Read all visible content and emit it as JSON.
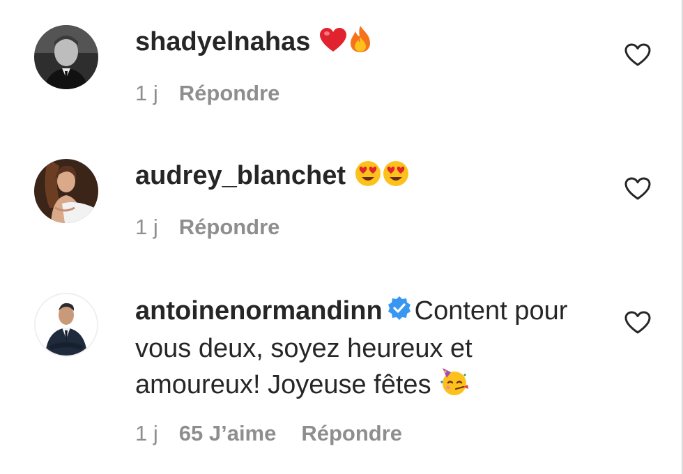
{
  "comments": [
    {
      "username": "shadyelnahas",
      "text": "",
      "emojis": [
        "red-heart-emoji",
        "fire-emoji"
      ],
      "time": "1 j",
      "likes": "",
      "reply_label": "Répondre",
      "verified": false
    },
    {
      "username": "audrey_blanchet",
      "text": "",
      "emojis": [
        "heart-eyes-emoji",
        "heart-eyes-emoji"
      ],
      "time": "1 j",
      "likes": "",
      "reply_label": "Répondre",
      "verified": false
    },
    {
      "username": "antoinenormandinn",
      "text": "Content pour vous deux, soyez heureux et amoureux! Joyeuse fêtes",
      "emojis": [
        "partying-face-emoji"
      ],
      "time": "1 j",
      "likes": "65 J’aime",
      "reply_label": "Répondre",
      "verified": true
    }
  ],
  "colors": {
    "text": "#262626",
    "secondary": "#8e8e8e",
    "verified": "#3897f0",
    "divider": "#dbdbdb"
  },
  "icons": {
    "like": "heart-outline-icon",
    "verified": "verified-badge-icon"
  }
}
